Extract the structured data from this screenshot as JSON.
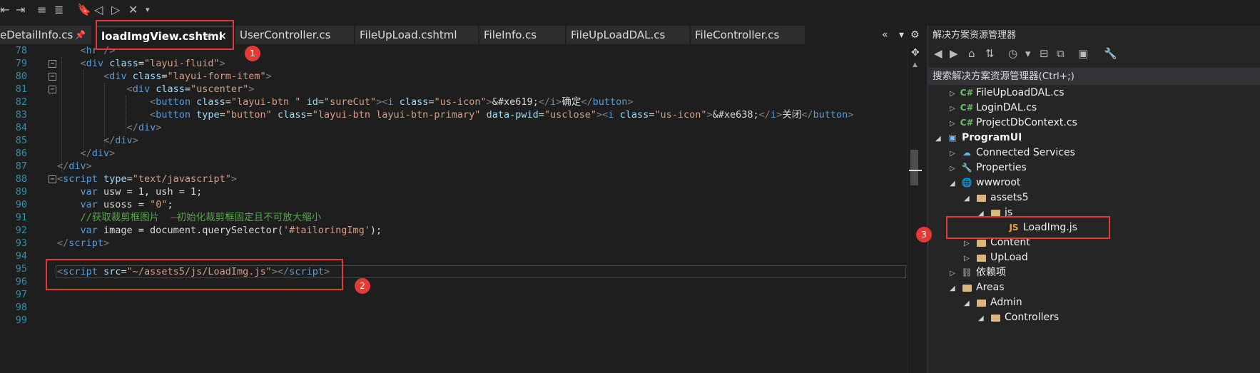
{
  "toolbar": {
    "icons": [
      "outdent-icon",
      "indent-icon",
      "comment-icon",
      "uncomment-icon",
      "bookmark-icon",
      "prev-bookmark-icon",
      "next-bookmark-icon",
      "clear-bookmark-icon",
      "overflow-icon"
    ]
  },
  "tabs": [
    {
      "label": "eDetailInfo.cs",
      "active": false,
      "pinned": true
    },
    {
      "label": "loadImgView.cshtml",
      "active": true,
      "pinned": true
    },
    {
      "label": "UserController.cs",
      "active": false
    },
    {
      "label": "FileUpLoad.cshtml",
      "active": false
    },
    {
      "label": "FileInfo.cs",
      "active": false
    },
    {
      "label": "FileUpLoadDAL.cs",
      "active": false
    },
    {
      "label": "FileController.cs",
      "active": false
    }
  ],
  "tab_controls": {
    "collapse": "«",
    "dropdown": "▾",
    "settings": "⚙"
  },
  "editor": {
    "line_numbers": [
      "78",
      "79",
      "80",
      "81",
      "82",
      "83",
      "84",
      "85",
      "86",
      "87",
      "88",
      "89",
      "90",
      "91",
      "92",
      "93",
      "94",
      "95",
      "96",
      "97",
      "98",
      "99"
    ],
    "current_line": "95"
  },
  "solution_explorer": {
    "title": "解决方案资源管理器",
    "search_placeholder": "搜索解决方案资源管理器(Ctrl+;)",
    "items": [
      {
        "label": "FileUpLoadDAL.cs",
        "icon": "C#"
      },
      {
        "label": "LoginDAL.cs",
        "icon": "C#"
      },
      {
        "label": "ProjectDbContext.cs",
        "icon": "C#"
      },
      {
        "label": "ProgramUI",
        "icon": "project"
      },
      {
        "label": "Connected Services",
        "icon": "services"
      },
      {
        "label": "Properties",
        "icon": "properties"
      },
      {
        "label": "wwwroot",
        "icon": "globe"
      },
      {
        "label": "assets5",
        "icon": "folder"
      },
      {
        "label": "js",
        "icon": "folder"
      },
      {
        "label": "LoadImg.js",
        "icon": "JS"
      },
      {
        "label": "Content",
        "icon": "folder"
      },
      {
        "label": "UpLoad",
        "icon": "folder"
      },
      {
        "label": "依赖项",
        "icon": "deps"
      },
      {
        "label": "Areas",
        "icon": "folder"
      },
      {
        "label": "Admin",
        "icon": "folder"
      },
      {
        "label": "Controllers",
        "icon": "folder"
      }
    ]
  },
  "annotations": [
    "1",
    "2",
    "3"
  ],
  "colors": {
    "annotation": "#e53935",
    "linenumber": "#2b91af",
    "tag": "#569cd6",
    "attr": "#9cdcfe",
    "string": "#d69d85",
    "comment": "#57a64a"
  }
}
